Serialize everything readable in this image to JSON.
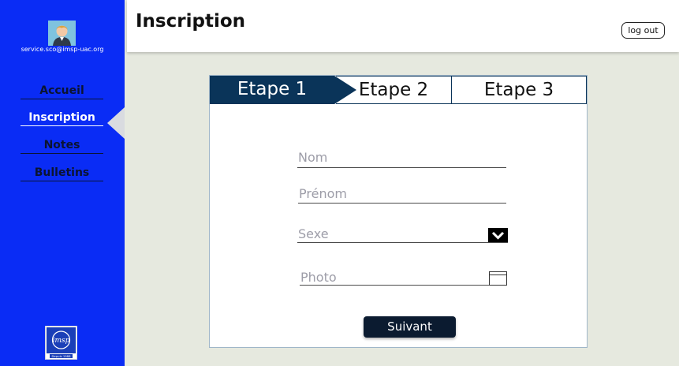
{
  "user": {
    "email": "service.sco@imsp-uac.org"
  },
  "nav": {
    "items": [
      {
        "label": "Accueil",
        "active": false
      },
      {
        "label": "Inscription",
        "active": true
      },
      {
        "label": "Notes",
        "active": false
      },
      {
        "label": "Bulletins",
        "active": false
      }
    ]
  },
  "header": {
    "title": "Inscription",
    "logout_label": "log out"
  },
  "steps": [
    {
      "label": "Etape 1",
      "active": true
    },
    {
      "label": "Etape 2",
      "active": false
    },
    {
      "label": "Etape 3",
      "active": false
    }
  ],
  "form": {
    "nom_placeholder": "Nom",
    "prenom_placeholder": "Prénom",
    "sexe_placeholder": "Sexe",
    "photo_placeholder": "Photo",
    "submit_label": "Suivant"
  },
  "logo": {
    "text": "imsp",
    "caption": "Depuis 1988"
  },
  "colors": {
    "sidebar": "#0a2cf5",
    "step_active": "#0a3459",
    "background": "#e6e9df",
    "button": "#0b1b30"
  }
}
